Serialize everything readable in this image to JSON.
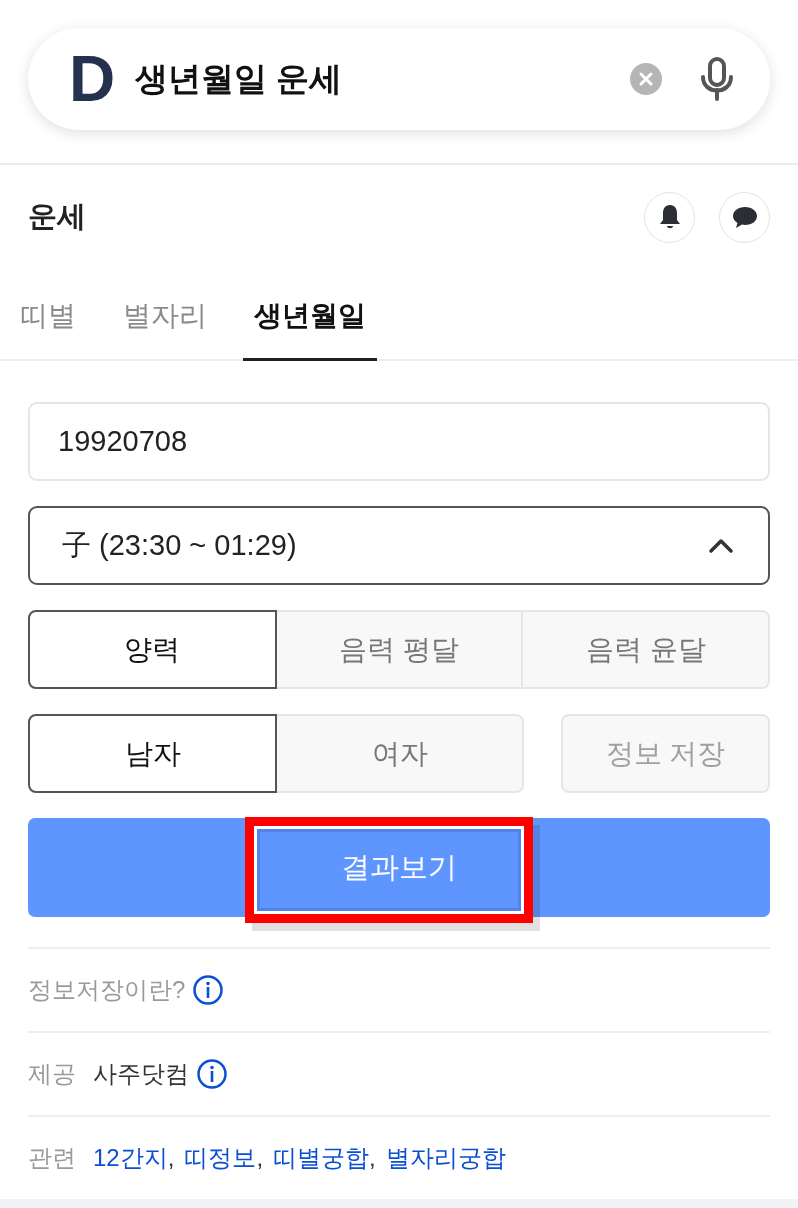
{
  "search": {
    "logo": "D",
    "query": "생년월일 운세"
  },
  "header": {
    "title": "운세"
  },
  "tabs": [
    {
      "label": "띠별",
      "selected": false
    },
    {
      "label": "별자리",
      "selected": false
    },
    {
      "label": "생년월일",
      "selected": true
    }
  ],
  "birthdate": {
    "value": "19920708"
  },
  "birth_time": {
    "value": "子 (23:30 ~ 01:29)",
    "expanded": true
  },
  "calendar_options": [
    {
      "label": "양력",
      "selected": true
    },
    {
      "label": "음력 평달",
      "selected": false
    },
    {
      "label": "음력 윤달",
      "selected": false
    }
  ],
  "gender_options": [
    {
      "label": "남자",
      "selected": true
    },
    {
      "label": "여자",
      "selected": false
    }
  ],
  "save_button": {
    "label": "정보 저장",
    "disabled": true
  },
  "submit_button": {
    "label": "결과보기",
    "highlighted": true
  },
  "info_rows": [
    {
      "kind": "help",
      "label": "정보저장이란?"
    },
    {
      "kind": "provider",
      "label": "제공",
      "value": "사주닷컴"
    },
    {
      "kind": "related",
      "label": "관련",
      "links": [
        "12간지",
        "띠정보",
        "띠별궁합",
        "별자리궁합"
      ],
      "separator": ","
    }
  ]
}
